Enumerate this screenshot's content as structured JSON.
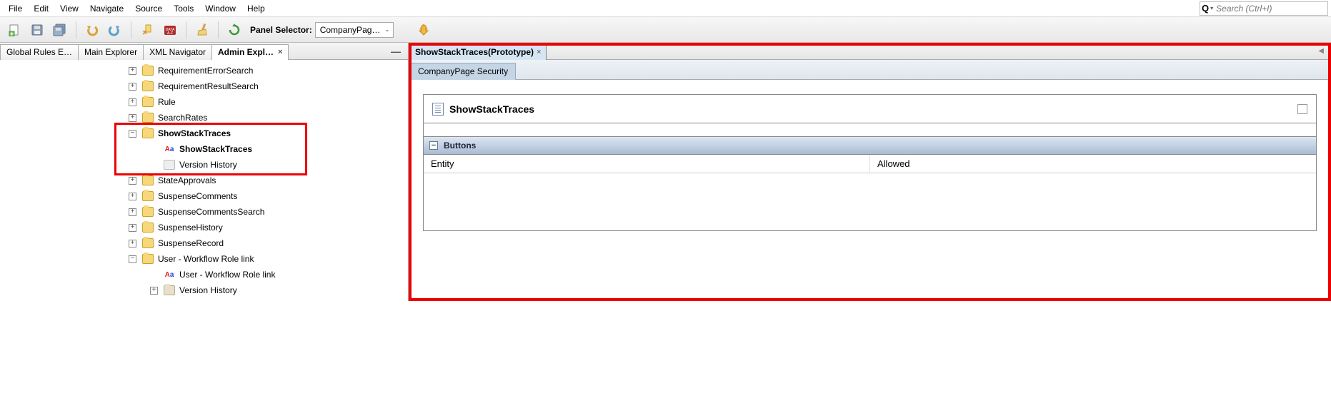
{
  "menu": {
    "items": [
      "File",
      "Edit",
      "View",
      "Navigate",
      "Source",
      "Tools",
      "Window",
      "Help"
    ]
  },
  "search": {
    "placeholder": "Search (Ctrl+I)"
  },
  "toolbar": {
    "panel_selector_label": "Panel Selector:",
    "panel_selector_value": "CompanyPag…"
  },
  "left_tabs": [
    {
      "label": "Global Rules E…",
      "closable": false
    },
    {
      "label": "Main Explorer",
      "closable": false
    },
    {
      "label": "XML Navigator",
      "closable": false
    },
    {
      "label": "Admin Expl…",
      "closable": true,
      "active": true
    }
  ],
  "tree": [
    {
      "label": "RequirementErrorSearch",
      "expander": "+",
      "icon": "folder",
      "indent": 0
    },
    {
      "label": "RequirementResultSearch",
      "expander": "+",
      "icon": "folder",
      "indent": 0
    },
    {
      "label": "Rule",
      "expander": "+",
      "icon": "folder",
      "indent": 0
    },
    {
      "label": "SearchRates",
      "expander": "+",
      "icon": "folder",
      "indent": 0
    },
    {
      "label": "ShowStackTraces",
      "expander": "-",
      "icon": "folder",
      "indent": 0,
      "bold": true
    },
    {
      "label": "ShowStackTraces",
      "expander": "",
      "icon": "aa",
      "indent": 1,
      "bold": true
    },
    {
      "label": "Version History",
      "expander": "",
      "icon": "hist",
      "indent": 1
    },
    {
      "label": "StateApprovals",
      "expander": "+",
      "icon": "folder",
      "indent": 0
    },
    {
      "label": "SuspenseComments",
      "expander": "+",
      "icon": "folder",
      "indent": 0
    },
    {
      "label": "SuspenseCommentsSearch",
      "expander": "+",
      "icon": "folder",
      "indent": 0
    },
    {
      "label": "SuspenseHistory",
      "expander": "+",
      "icon": "folder",
      "indent": 0
    },
    {
      "label": "SuspenseRecord",
      "expander": "+",
      "icon": "folder",
      "indent": 0
    },
    {
      "label": "User - Workflow Role link",
      "expander": "-",
      "icon": "folder",
      "indent": 0
    },
    {
      "label": "User - Workflow Role link",
      "expander": "",
      "icon": "aa",
      "indent": 1
    },
    {
      "label": "Version History",
      "expander": "+",
      "icon": "folder-beige",
      "indent": 1
    }
  ],
  "tree_highlight": {
    "start": 4,
    "end": 6
  },
  "editor": {
    "tab_label": "ShowStackTraces(Prototype)",
    "sub_tab": "CompanyPage Security",
    "title": "ShowStackTraces",
    "section": "Buttons",
    "columns": [
      "Entity",
      "Allowed"
    ]
  }
}
